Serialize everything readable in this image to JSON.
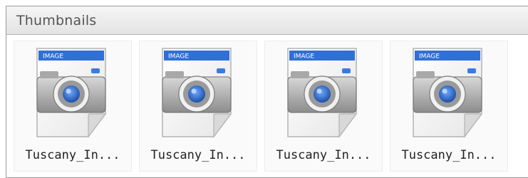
{
  "panel": {
    "title": "Thumbnails"
  },
  "thumbnails": [
    {
      "label": "Tuscany_In...",
      "icon": "image-file-icon",
      "badge": "IMAGE"
    },
    {
      "label": "Tuscany_In...",
      "icon": "image-file-icon",
      "badge": "IMAGE"
    },
    {
      "label": "Tuscany_In...",
      "icon": "image-file-icon",
      "badge": "IMAGE"
    },
    {
      "label": "Tuscany_In...",
      "icon": "image-file-icon",
      "badge": "IMAGE"
    }
  ],
  "colors": {
    "badge_blue": "#2f6fd6",
    "lens_blue": "#2a6fd0"
  }
}
